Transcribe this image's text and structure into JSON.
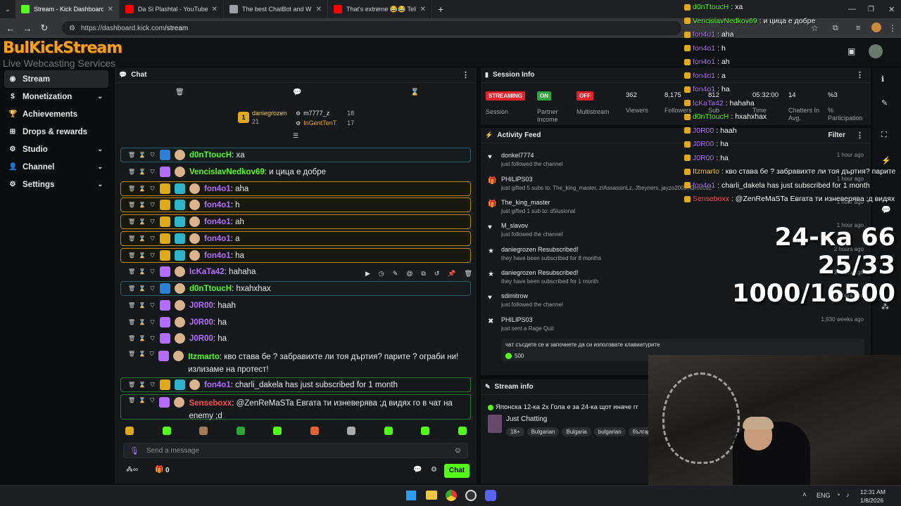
{
  "browser": {
    "tabs": [
      {
        "title": "Stream - Kick Dashboard",
        "color": "#53fc18",
        "active": true
      },
      {
        "title": "Da Si Plashtal - YouTube",
        "color": "#ff0000",
        "active": false
      },
      {
        "title": "The best ChatBot and Widgets",
        "color": "#9aa0a6",
        "active": false
      },
      {
        "title": "That's extreme 😂😂 Tell me w",
        "color": "#ff0000",
        "active": false
      }
    ],
    "url_host": "https://dashboard.kick.com",
    "url_path": "/stream"
  },
  "logo": {
    "line1": "BulKickStream",
    "line2": "Live Webcasting Services"
  },
  "sidebar": {
    "items": [
      {
        "label": "Stream",
        "icon": "broadcast-icon",
        "chevron": false
      },
      {
        "label": "Monetization",
        "icon": "dollar-icon",
        "chevron": true
      },
      {
        "label": "Achievements",
        "icon": "trophy-icon",
        "chevron": false
      },
      {
        "label": "Drops & rewards",
        "icon": "gift-icon",
        "chevron": false
      },
      {
        "label": "Studio",
        "icon": "gear-icon",
        "chevron": true
      },
      {
        "label": "Channel",
        "icon": "person-icon",
        "chevron": true
      },
      {
        "label": "Settings",
        "icon": "gear-icon",
        "chevron": true
      }
    ]
  },
  "chat": {
    "title": "Chat",
    "gifters": [
      {
        "rank": "1",
        "name": "daniegrozen",
        "count": "21"
      },
      {
        "rank": "",
        "name": "m7777_z",
        "count": "18"
      },
      {
        "rank": "",
        "name": "InGentTenT",
        "count": "17"
      }
    ],
    "messages": [
      {
        "user": "d0nTtoucH",
        "color": "#53fc18",
        "text": ": xa",
        "style": "hlb"
      },
      {
        "user": "VencislavNedkov69",
        "color": "#53fc18",
        "text": ": и цица е добре",
        "style": ""
      },
      {
        "user": "fon4o1",
        "color": "#b46cff",
        "text": ": aha",
        "style": "hl"
      },
      {
        "user": "fon4o1",
        "color": "#b46cff",
        "text": ": h",
        "style": "hl"
      },
      {
        "user": "fon4o1",
        "color": "#b46cff",
        "text": ": ah",
        "style": "hl"
      },
      {
        "user": "fon4o1",
        "color": "#b46cff",
        "text": ": a",
        "style": "hl"
      },
      {
        "user": "fon4o1",
        "color": "#b46cff",
        "text": ": ha",
        "style": "hl"
      },
      {
        "user": "IcKaTa42",
        "color": "#b46cff",
        "text": ": hahaha",
        "style": ""
      },
      {
        "user": "d0nTtoucH",
        "color": "#53fc18",
        "text": ": hxahxhax",
        "style": "hlb"
      },
      {
        "user": "J0R00",
        "color": "#b46cff",
        "text": ": haah",
        "style": ""
      },
      {
        "user": "J0R00",
        "color": "#b46cff",
        "text": ": ha",
        "style": ""
      },
      {
        "user": "J0R00",
        "color": "#b46cff",
        "text": ": ha",
        "style": ""
      },
      {
        "user": "Itzmarto",
        "color": "#53fc18",
        "text": ": кво става бе ? забравихте ли тоя дъртия? парите ? ограби ни! излизаме на протест!",
        "style": ""
      },
      {
        "user": "fon4o1",
        "color": "#b46cff",
        "text": ": charli_dakela has just subscribed for 1 month",
        "style": "hlg"
      },
      {
        "user": "Senseboxx",
        "color": "#ff4e4e",
        "text": ": @ZenReMaSTa Евгата ти изневерява ;д видях го в чат на enemy ;d",
        "style": "hlg"
      }
    ],
    "input_placeholder": "Send a message",
    "footer_count": "0",
    "send_label": "Chat"
  },
  "session": {
    "title": "Session Info",
    "status_pills": [
      {
        "label": "STREAMING",
        "color": "#e8202a",
        "caption": "Session"
      },
      {
        "label": "ON",
        "color": "#2da63a",
        "caption": "Partner Income"
      },
      {
        "label": "OFF",
        "color": "#e8202a",
        "caption": "Multistream"
      }
    ],
    "stats": [
      {
        "value": "362",
        "caption": "Viewers"
      },
      {
        "value": "8,175",
        "caption": "Followers"
      },
      {
        "value": "812",
        "caption": "Sub"
      },
      {
        "value": "05:32:00",
        "caption": "Time"
      },
      {
        "value": "14",
        "caption": "Chatters In Avg."
      },
      {
        "value": "%3",
        "caption": "% Participation"
      }
    ]
  },
  "activity": {
    "title": "Activity Feed",
    "filter_label": "Filter",
    "items": [
      {
        "icon": "heart-icon",
        "name": "donkel7774",
        "sub": "just followed the channel",
        "time": "1 hour ago"
      },
      {
        "icon": "gift-icon",
        "name": "PHILIPS03",
        "sub": "just gifted 5 subs to: The_king_master, zIAssassinLz, Jfreyners, jayzo2009, GreeceZ",
        "time": "1 hour ago"
      },
      {
        "icon": "gift-icon",
        "name": "The_king_master",
        "sub": "just gifted 1 sub to: d5lusional",
        "time": "1 hour ago"
      },
      {
        "icon": "heart-icon",
        "name": "M_slavov",
        "sub": "just followed the channel",
        "time": "1 hour ago"
      },
      {
        "icon": "star-icon",
        "name": "daniegrozen Resubscribed!",
        "sub": "they have been subscribed for 8 months",
        "time": "2 hours ago"
      },
      {
        "icon": "star-icon",
        "name": "daniegrozen Resubscribed!",
        "sub": "they have been subscribed for 1 month",
        "time": "2 hours ago"
      },
      {
        "icon": "heart-icon",
        "name": "sdimitrow",
        "sub": "just followed the channel",
        "time": "2 hours ago"
      },
      {
        "icon": "kick-icon",
        "name": "PHILIPS03",
        "sub": "just sent a Rage Quit",
        "time": "1,930 weeks ago"
      }
    ],
    "rage_text": "чат съсдете се и започнете да си използвате клавиатурите",
    "rage_amount": "500"
  },
  "stream_info": {
    "title": "Stream info",
    "stream_title": "Японска 12-ка 2х Гола е за 24-ка щот иначе гг",
    "category": "Just Chatting",
    "tags": [
      "18+",
      "Bulgarian",
      "Bulgaria",
      "bulgarian",
      "българ"
    ]
  },
  "overlay": {
    "lines": [
      {
        "user": "d0nTtoucH",
        "text": ": xa",
        "color": "#53fc18"
      },
      {
        "user": "VencislavNedkov69",
        "text": ": и цица е добре",
        "color": "#53fc18"
      },
      {
        "user": "fon4o1",
        "text": ": aha",
        "color": "#b46cff"
      },
      {
        "user": "fon4o1",
        "text": ": h",
        "color": "#b46cff"
      },
      {
        "user": "fon4o1",
        "text": ": ah",
        "color": "#b46cff"
      },
      {
        "user": "fon4o1",
        "text": ": a",
        "color": "#b46cff"
      },
      {
        "user": "fon4o1",
        "text": ": ha",
        "color": "#b46cff"
      },
      {
        "user": "IcKaTa42",
        "text": ": hahaha",
        "color": "#b46cff"
      },
      {
        "user": "d0nTtoucH",
        "text": ": hxahxhax",
        "color": "#53fc18"
      },
      {
        "user": "J0R00",
        "text": ": haah",
        "color": "#b46cff"
      },
      {
        "user": "J0R00",
        "text": ": ha",
        "color": "#b46cff"
      },
      {
        "user": "J0R00",
        "text": ": ha",
        "color": "#b46cff"
      },
      {
        "user": "Itzmarto",
        "text": ": кво става бе ? забравихте ли тоя дъртия? парите",
        "color": "#f2c94c"
      },
      {
        "user": "fon4o1",
        "text": ": charli_dakela has just subscribed for 1 month",
        "color": "#b46cff"
      },
      {
        "user": "Senseboxx",
        "text": ": @ZenReMaSTa Евгата ти изневерява ;д видях",
        "color": "#ff4e4e"
      }
    ],
    "big_line1": "24-ка 66 25/33",
    "big_line2": "1000/16500"
  },
  "taskbar": {
    "lang": "ENG",
    "time": "12:31 AM",
    "date": "1/8/2026"
  }
}
